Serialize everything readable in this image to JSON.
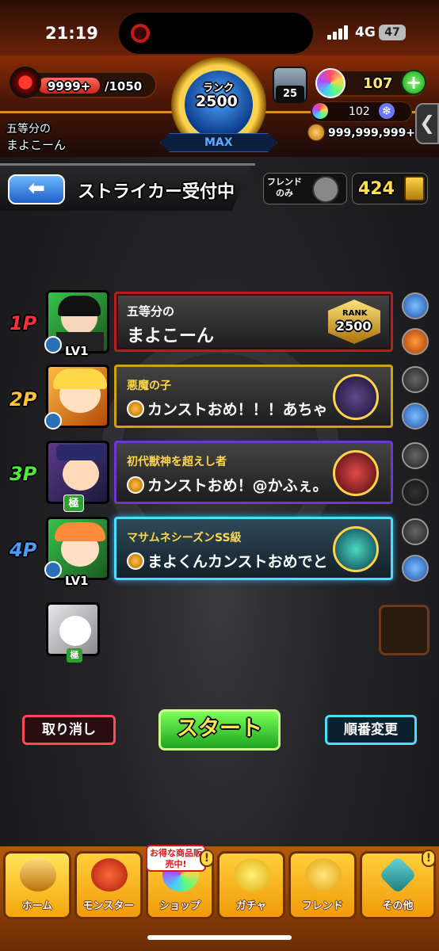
{
  "status_bar": {
    "time": "21:19",
    "network": "4G",
    "battery": "47"
  },
  "header": {
    "stamina": "9999+",
    "stamina_max": "/1050",
    "title": "五等分の",
    "player_name": "まよこーん",
    "rank_label": "ランク",
    "rank": "2500",
    "rank_max": "MAX",
    "level_badge": "25",
    "gems": "107",
    "orbs": "102",
    "coins": "999,999,999+"
  },
  "section": {
    "title": "ストライカー受付中",
    "friend_only": "フレンドのみ",
    "count": "424"
  },
  "players": [
    {
      "slot": "1P",
      "title": "五等分の",
      "name": "まよこーん",
      "level": "LV1",
      "badge_top": "RANK",
      "badge_rank": "2500",
      "color": "#ff2f3a"
    },
    {
      "slot": "2P",
      "title": "悪魔の子",
      "message": "カンストおめ！！！あちゃ",
      "color": "#ffc23a"
    },
    {
      "slot": "3P",
      "title": "初代獣神を超えし者",
      "message": "カンストおめ！@かふぇ。",
      "extra": "極",
      "color": "#4aee3a"
    },
    {
      "slot": "4P",
      "title": "マサムネシーズンSS級",
      "message": "まよくんカンストおめでと",
      "level": "LV1",
      "color": "#4a9cff"
    }
  ],
  "helper": {
    "badge": "極"
  },
  "buttons": {
    "cancel": "取り消し",
    "start": "スタート",
    "order": "順番変更"
  },
  "nav": {
    "promo": "お得な商品販売中!",
    "items": [
      "ホーム",
      "モンスター",
      "ショップ",
      "ガチャ",
      "フレンド",
      "その他"
    ]
  }
}
